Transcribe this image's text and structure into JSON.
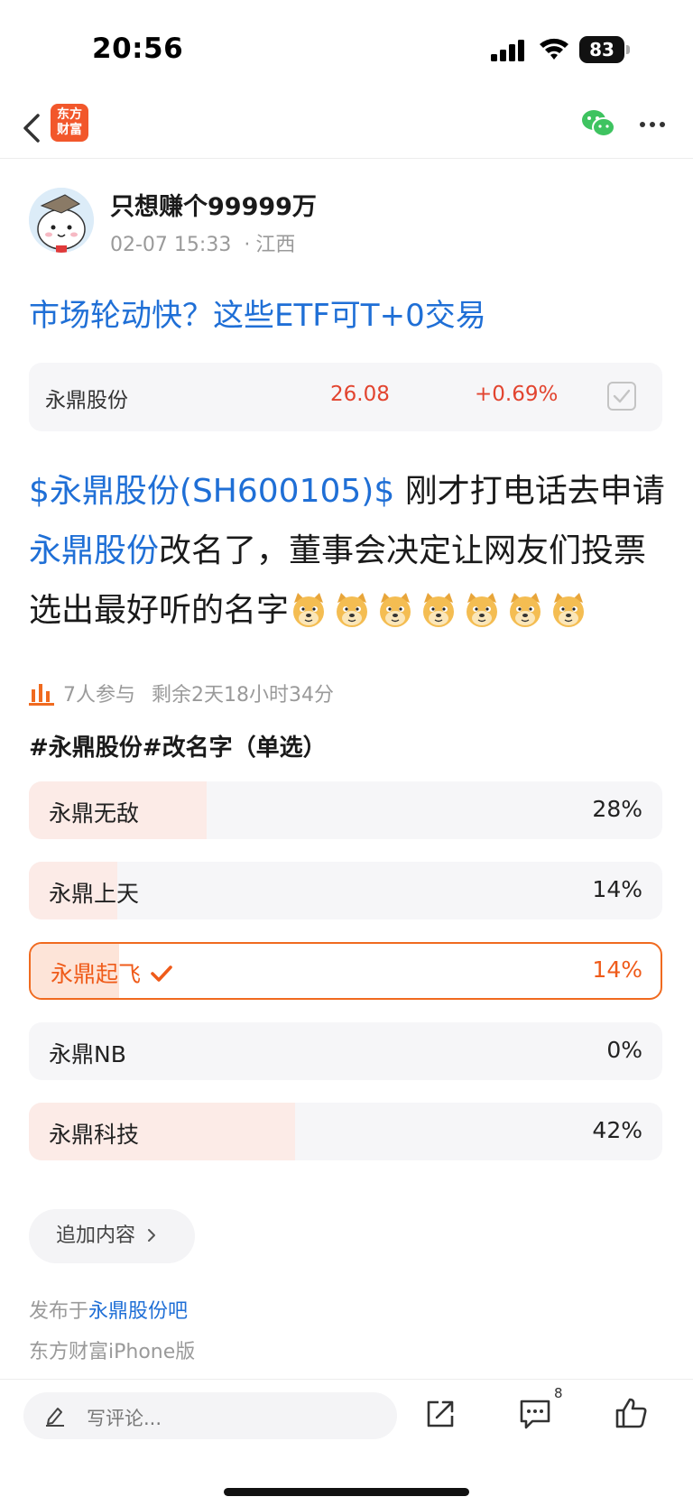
{
  "status_bar": {
    "time": "20:56",
    "battery": "83"
  },
  "nav": {
    "logo_line1": "东方",
    "logo_line2": "财富"
  },
  "author": {
    "name": "只想赚个99999万",
    "date": "02-07 15:33",
    "location": "江西"
  },
  "post": {
    "title": "市场轮动快？这些ETF可T+0交易",
    "body_link1": "$永鼎股份(SH600105)$",
    "body_text1": " 刚才打电话去申请",
    "body_link2": "永鼎股份",
    "body_text2": "改名了，董事会决定让网友们投票选出最好听的名字",
    "emoji_count": 7
  },
  "stock_card": {
    "name": "永鼎股份",
    "price": "26.08",
    "change": "+0.69%"
  },
  "poll": {
    "participants": "7人参与",
    "remaining": "剩余2天18小时34分",
    "title": "#永鼎股份#改名字（单选）",
    "options": [
      {
        "label": "永鼎无敌",
        "percent": "28%",
        "value": 0.28,
        "selected": false
      },
      {
        "label": "永鼎上天",
        "percent": "14%",
        "value": 0.14,
        "selected": false
      },
      {
        "label": "永鼎起飞",
        "percent": "14%",
        "value": 0.14,
        "selected": true
      },
      {
        "label": "永鼎NB",
        "percent": "0%",
        "value": 0.0,
        "selected": false
      },
      {
        "label": "永鼎科技",
        "percent": "42%",
        "value": 0.42,
        "selected": false
      }
    ]
  },
  "append_button": "追加内容",
  "footer": {
    "published_prefix": "发布于",
    "published_link": "永鼎股份吧",
    "client": "东方财富iPhone版"
  },
  "bottom_bar": {
    "comment_placeholder": "写评论...",
    "comment_count": "8"
  },
  "colors": {
    "link": "#1f6fd6",
    "accent": "#ef5b1a",
    "price_up": "#e2442f"
  },
  "icons": [
    "back-icon",
    "wechat-icon",
    "more-icon",
    "check-icon",
    "bars-icon",
    "doge-emoji",
    "chevron-right-icon",
    "pen-icon",
    "share-icon",
    "comment-icon",
    "like-icon"
  ]
}
